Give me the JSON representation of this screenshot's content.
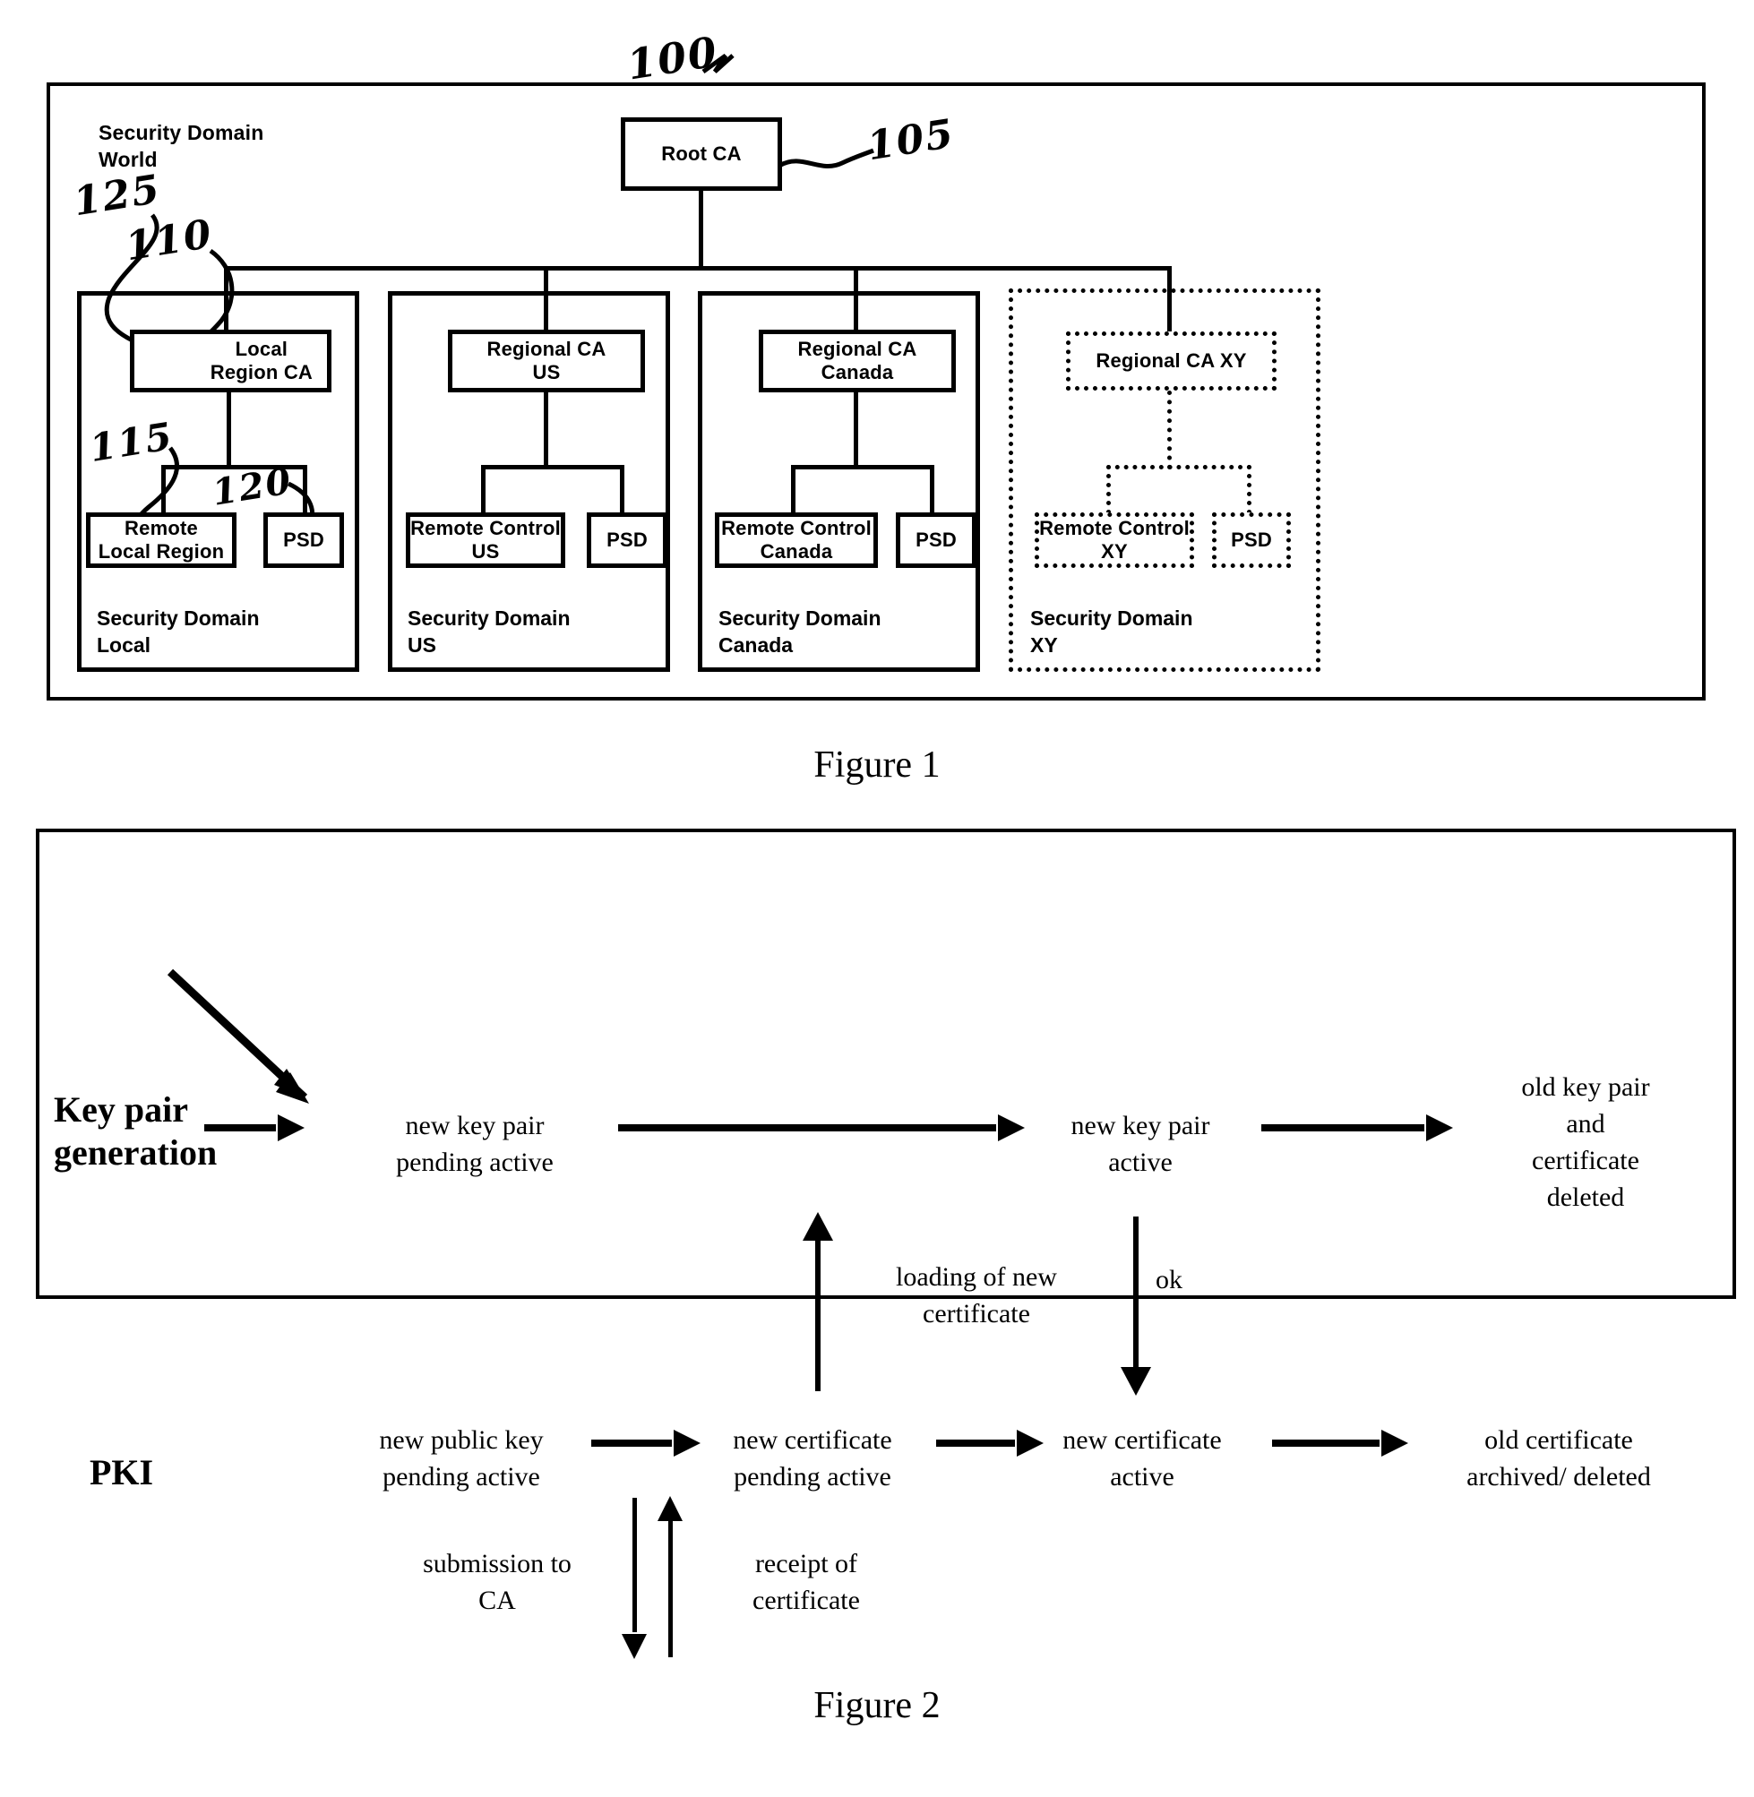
{
  "figure1": {
    "caption": "Figure 1",
    "world_domain_label": "Security Domain\nWorld",
    "root": {
      "label": "Root CA"
    },
    "annotations": [
      {
        "id": "100",
        "text": "100"
      },
      {
        "id": "105",
        "text": "105"
      },
      {
        "id": "110",
        "text": "110"
      },
      {
        "id": "115",
        "text": "115"
      },
      {
        "id": "120",
        "text": "120"
      },
      {
        "id": "125",
        "text": "125"
      }
    ],
    "domains": [
      {
        "key": "local",
        "ca_label": "Local\nRegion CA",
        "remote_label": "Remote\nLocal Region",
        "psd_label": "PSD",
        "domain_label": "Security Domain\nLocal",
        "style": "solid"
      },
      {
        "key": "us",
        "ca_label": "Regional CA\nUS",
        "remote_label": "Remote Control\nUS",
        "psd_label": "PSD",
        "domain_label": "Security Domain\nUS",
        "style": "solid"
      },
      {
        "key": "canada",
        "ca_label": "Regional CA\nCanada",
        "remote_label": "Remote Control\nCanada",
        "psd_label": "PSD",
        "domain_label": "Security Domain\nCanada",
        "style": "solid"
      },
      {
        "key": "xy",
        "ca_label": "Regional CA XY",
        "remote_label": "Remote Control\nXY",
        "psd_label": "PSD",
        "domain_label": "Security Domain\nXY",
        "style": "dotted"
      }
    ]
  },
  "figure2": {
    "caption": "Figure 2",
    "lanes": {
      "keypair_title": "Key pair\ngeneration",
      "pki_title": "PKI"
    },
    "states": {
      "new_key_pair_pending_active": "new key pair\npending active",
      "new_key_pair_active": "new key pair\nactive",
      "old_key_pair_and_certificate_deleted": "old key pair\nand\ncertificate\ndeleted",
      "new_public_key_pending_active": "new public key\npending active",
      "new_certificate_pending_active": "new certificate\npending active",
      "new_certificate_active": "new certificate\nactive",
      "old_certificate_archived_deleted": "old certificate\narchived/ deleted"
    },
    "transitions": {
      "loading_of_new_certificate": "loading of new\ncertificate",
      "ok": "ok",
      "submission_to_ca": "submission to\nCA",
      "receipt_of_certificate": "receipt of\ncertificate"
    }
  },
  "colors": {
    "ink": "#000000",
    "paper": "#ffffff"
  }
}
